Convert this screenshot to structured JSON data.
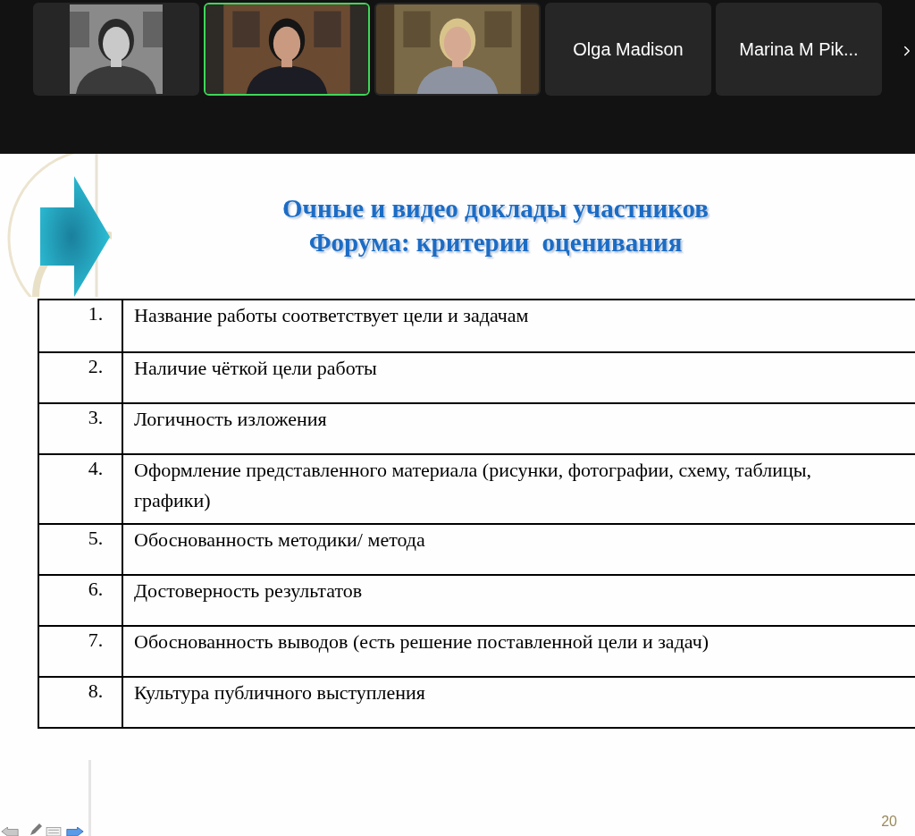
{
  "participants": [
    {
      "kind": "video",
      "active_speaker": false
    },
    {
      "kind": "video",
      "active_speaker": true
    },
    {
      "kind": "video",
      "active_speaker": false
    },
    {
      "kind": "name",
      "name": "Olga Madison",
      "active_speaker": false
    },
    {
      "kind": "name",
      "name": "Marina M Pik...",
      "active_speaker": false
    }
  ],
  "slide": {
    "title_lines": [
      "Очные и видео доклады участников",
      "Форума: критерии  оценивания"
    ],
    "rows": [
      {
        "number": "1.",
        "text": "Название работы соответствует цели и задачам"
      },
      {
        "number": "2.",
        "text": "Наличие чёткой цели работы"
      },
      {
        "number": "3.",
        "text": "Логичность изложения"
      },
      {
        "number": "4.",
        "text": "Оформление представленного материала (рисунки, фотографии, схему, таблицы, графики)"
      },
      {
        "number": "5.",
        "text": "Обоснованность методики/ метода"
      },
      {
        "number": "6.",
        "text": "Достоверность результатов"
      },
      {
        "number": "7.",
        "text": "Обоснованность выводов (есть решение поставленной цели и задач)"
      },
      {
        "number": "8.",
        "text": "Культура публичного выступления"
      }
    ],
    "page_number": "20"
  }
}
